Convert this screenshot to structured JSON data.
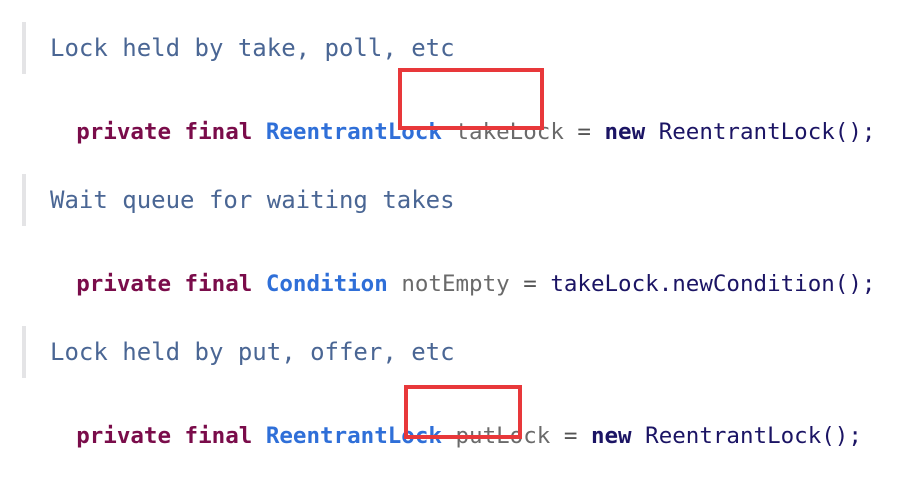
{
  "colors": {
    "highlight_border": "#e8383a",
    "comment_text": "#4a6694",
    "keyword": "#7a0c4a",
    "type": "#2f6fd8",
    "field": "#6a6a6a",
    "new_keyword": "#1b1464"
  },
  "blocks": [
    {
      "comment": "Lock held by take, poll, etc",
      "modifiers": "private final",
      "type": "ReentrantLock",
      "field": "takeLock",
      "assign": "=",
      "new_kw": "new",
      "initializer": "ReentrantLock();"
    },
    {
      "comment": "Wait queue for waiting takes",
      "modifiers": "private final",
      "type": "Condition",
      "field": "notEmpty",
      "assign": "=",
      "receiver": "takeLock",
      "dot": ".",
      "initializer": "newCondition();"
    },
    {
      "comment": "Lock held by put, offer, etc",
      "modifiers": "private final",
      "type": "ReentrantLock",
      "field": "putLock",
      "assign": "=",
      "new_kw": "new",
      "initializer": "ReentrantLock();"
    }
  ]
}
